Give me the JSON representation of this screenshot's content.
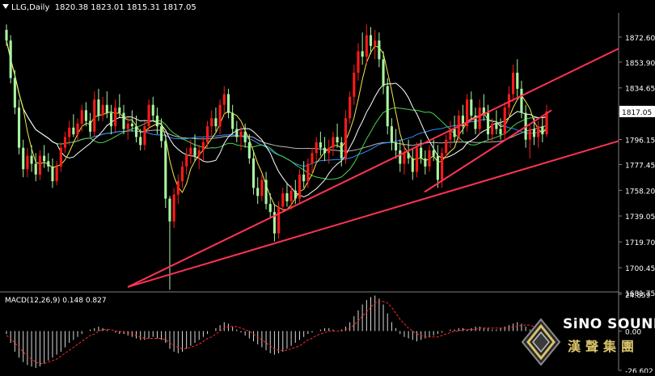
{
  "header": {
    "symbol": "LLG,Daily",
    "ohlc": "1820.38 1823.01 1815.31 1817.05"
  },
  "chart_data": [
    {
      "type": "candlestick",
      "title": "LLG,Daily",
      "ylim": [
        1681.75,
        1887
      ],
      "yticks": [
        "1872.60",
        "1853.90",
        "1834.65",
        "1815.35",
        "1796.15",
        "1777.45",
        "1758.20",
        "1739.05",
        "1719.70",
        "1700.45",
        "1681.75"
      ],
      "current_price": "1817.05",
      "candles": [
        {
          "o": 1878,
          "h": 1882,
          "l": 1866,
          "c": 1870
        },
        {
          "o": 1870,
          "h": 1874,
          "l": 1838,
          "c": 1842
        },
        {
          "o": 1842,
          "h": 1848,
          "l": 1815,
          "c": 1820
        },
        {
          "o": 1820,
          "h": 1826,
          "l": 1785,
          "c": 1790
        },
        {
          "o": 1790,
          "h": 1796,
          "l": 1768,
          "c": 1774
        },
        {
          "o": 1774,
          "h": 1790,
          "l": 1768,
          "c": 1784
        },
        {
          "o": 1784,
          "h": 1792,
          "l": 1772,
          "c": 1778
        },
        {
          "o": 1778,
          "h": 1786,
          "l": 1765,
          "c": 1770
        },
        {
          "o": 1770,
          "h": 1788,
          "l": 1766,
          "c": 1784
        },
        {
          "o": 1784,
          "h": 1792,
          "l": 1775,
          "c": 1780
        },
        {
          "o": 1780,
          "h": 1786,
          "l": 1772,
          "c": 1776
        },
        {
          "o": 1776,
          "h": 1782,
          "l": 1760,
          "c": 1765
        },
        {
          "o": 1765,
          "h": 1780,
          "l": 1762,
          "c": 1776
        },
        {
          "o": 1776,
          "h": 1794,
          "l": 1772,
          "c": 1790
        },
        {
          "o": 1790,
          "h": 1802,
          "l": 1786,
          "c": 1798
        },
        {
          "o": 1798,
          "h": 1810,
          "l": 1792,
          "c": 1805
        },
        {
          "o": 1805,
          "h": 1815,
          "l": 1798,
          "c": 1800
        },
        {
          "o": 1800,
          "h": 1812,
          "l": 1795,
          "c": 1808
        },
        {
          "o": 1808,
          "h": 1822,
          "l": 1802,
          "c": 1818
        },
        {
          "o": 1818,
          "h": 1824,
          "l": 1806,
          "c": 1810
        },
        {
          "o": 1810,
          "h": 1816,
          "l": 1798,
          "c": 1802
        },
        {
          "o": 1802,
          "h": 1832,
          "l": 1798,
          "c": 1826
        },
        {
          "o": 1826,
          "h": 1834,
          "l": 1810,
          "c": 1814
        },
        {
          "o": 1814,
          "h": 1828,
          "l": 1810,
          "c": 1822
        },
        {
          "o": 1822,
          "h": 1832,
          "l": 1812,
          "c": 1816
        },
        {
          "o": 1816,
          "h": 1822,
          "l": 1800,
          "c": 1806
        },
        {
          "o": 1806,
          "h": 1826,
          "l": 1802,
          "c": 1820
        },
        {
          "o": 1820,
          "h": 1830,
          "l": 1812,
          "c": 1816
        },
        {
          "o": 1816,
          "h": 1822,
          "l": 1800,
          "c": 1804
        },
        {
          "o": 1804,
          "h": 1812,
          "l": 1796,
          "c": 1808
        },
        {
          "o": 1808,
          "h": 1818,
          "l": 1802,
          "c": 1806
        },
        {
          "o": 1806,
          "h": 1814,
          "l": 1794,
          "c": 1798
        },
        {
          "o": 1798,
          "h": 1804,
          "l": 1788,
          "c": 1792
        },
        {
          "o": 1792,
          "h": 1810,
          "l": 1788,
          "c": 1806
        },
        {
          "o": 1806,
          "h": 1826,
          "l": 1802,
          "c": 1822
        },
        {
          "o": 1822,
          "h": 1828,
          "l": 1810,
          "c": 1814
        },
        {
          "o": 1814,
          "h": 1820,
          "l": 1800,
          "c": 1806
        },
        {
          "o": 1806,
          "h": 1812,
          "l": 1790,
          "c": 1795
        },
        {
          "o": 1795,
          "h": 1800,
          "l": 1745,
          "c": 1752
        },
        {
          "o": 1752,
          "h": 1754,
          "l": 1684,
          "c": 1735
        },
        {
          "o": 1735,
          "h": 1760,
          "l": 1730,
          "c": 1755
        },
        {
          "o": 1755,
          "h": 1770,
          "l": 1748,
          "c": 1765
        },
        {
          "o": 1765,
          "h": 1780,
          "l": 1760,
          "c": 1776
        },
        {
          "o": 1776,
          "h": 1790,
          "l": 1770,
          "c": 1785
        },
        {
          "o": 1785,
          "h": 1796,
          "l": 1778,
          "c": 1790
        },
        {
          "o": 1790,
          "h": 1800,
          "l": 1780,
          "c": 1784
        },
        {
          "o": 1784,
          "h": 1792,
          "l": 1774,
          "c": 1788
        },
        {
          "o": 1788,
          "h": 1798,
          "l": 1780,
          "c": 1794
        },
        {
          "o": 1794,
          "h": 1810,
          "l": 1790,
          "c": 1806
        },
        {
          "o": 1806,
          "h": 1818,
          "l": 1798,
          "c": 1812
        },
        {
          "o": 1812,
          "h": 1820,
          "l": 1802,
          "c": 1806
        },
        {
          "o": 1806,
          "h": 1826,
          "l": 1800,
          "c": 1822
        },
        {
          "o": 1822,
          "h": 1836,
          "l": 1815,
          "c": 1830
        },
        {
          "o": 1830,
          "h": 1834,
          "l": 1812,
          "c": 1816
        },
        {
          "o": 1816,
          "h": 1822,
          "l": 1800,
          "c": 1804
        },
        {
          "o": 1804,
          "h": 1810,
          "l": 1794,
          "c": 1798
        },
        {
          "o": 1798,
          "h": 1806,
          "l": 1788,
          "c": 1802
        },
        {
          "o": 1802,
          "h": 1808,
          "l": 1790,
          "c": 1794
        },
        {
          "o": 1794,
          "h": 1800,
          "l": 1778,
          "c": 1782
        },
        {
          "o": 1782,
          "h": 1788,
          "l": 1755,
          "c": 1760
        },
        {
          "o": 1760,
          "h": 1768,
          "l": 1748,
          "c": 1754
        },
        {
          "o": 1754,
          "h": 1770,
          "l": 1750,
          "c": 1766
        },
        {
          "o": 1766,
          "h": 1772,
          "l": 1744,
          "c": 1748
        },
        {
          "o": 1748,
          "h": 1756,
          "l": 1738,
          "c": 1742
        },
        {
          "o": 1742,
          "h": 1748,
          "l": 1720,
          "c": 1726
        },
        {
          "o": 1726,
          "h": 1750,
          "l": 1722,
          "c": 1746
        },
        {
          "o": 1746,
          "h": 1760,
          "l": 1742,
          "c": 1756
        },
        {
          "o": 1756,
          "h": 1764,
          "l": 1746,
          "c": 1750
        },
        {
          "o": 1750,
          "h": 1762,
          "l": 1744,
          "c": 1758
        },
        {
          "o": 1758,
          "h": 1766,
          "l": 1748,
          "c": 1752
        },
        {
          "o": 1752,
          "h": 1774,
          "l": 1748,
          "c": 1770
        },
        {
          "o": 1770,
          "h": 1780,
          "l": 1760,
          "c": 1765
        },
        {
          "o": 1765,
          "h": 1782,
          "l": 1760,
          "c": 1778
        },
        {
          "o": 1778,
          "h": 1790,
          "l": 1770,
          "c": 1786
        },
        {
          "o": 1786,
          "h": 1798,
          "l": 1780,
          "c": 1794
        },
        {
          "o": 1794,
          "h": 1802,
          "l": 1784,
          "c": 1790
        },
        {
          "o": 1790,
          "h": 1798,
          "l": 1780,
          "c": 1786
        },
        {
          "o": 1786,
          "h": 1796,
          "l": 1778,
          "c": 1790
        },
        {
          "o": 1790,
          "h": 1802,
          "l": 1784,
          "c": 1798
        },
        {
          "o": 1798,
          "h": 1808,
          "l": 1790,
          "c": 1794
        },
        {
          "o": 1794,
          "h": 1798,
          "l": 1776,
          "c": 1782
        },
        {
          "o": 1782,
          "h": 1818,
          "l": 1778,
          "c": 1812
        },
        {
          "o": 1812,
          "h": 1832,
          "l": 1808,
          "c": 1828
        },
        {
          "o": 1828,
          "h": 1852,
          "l": 1822,
          "c": 1846
        },
        {
          "o": 1846,
          "h": 1868,
          "l": 1840,
          "c": 1862
        },
        {
          "o": 1862,
          "h": 1876,
          "l": 1852,
          "c": 1858
        },
        {
          "o": 1858,
          "h": 1882,
          "l": 1852,
          "c": 1874
        },
        {
          "o": 1874,
          "h": 1880,
          "l": 1860,
          "c": 1866
        },
        {
          "o": 1866,
          "h": 1878,
          "l": 1856,
          "c": 1870
        },
        {
          "o": 1870,
          "h": 1876,
          "l": 1850,
          "c": 1856
        },
        {
          "o": 1856,
          "h": 1862,
          "l": 1830,
          "c": 1836
        },
        {
          "o": 1836,
          "h": 1842,
          "l": 1800,
          "c": 1806
        },
        {
          "o": 1806,
          "h": 1812,
          "l": 1788,
          "c": 1794
        },
        {
          "o": 1794,
          "h": 1804,
          "l": 1782,
          "c": 1788
        },
        {
          "o": 1788,
          "h": 1796,
          "l": 1772,
          "c": 1778
        },
        {
          "o": 1778,
          "h": 1792,
          "l": 1770,
          "c": 1786
        },
        {
          "o": 1786,
          "h": 1796,
          "l": 1778,
          "c": 1782
        },
        {
          "o": 1782,
          "h": 1790,
          "l": 1766,
          "c": 1772
        },
        {
          "o": 1772,
          "h": 1794,
          "l": 1768,
          "c": 1790
        },
        {
          "o": 1790,
          "h": 1796,
          "l": 1778,
          "c": 1782
        },
        {
          "o": 1782,
          "h": 1788,
          "l": 1770,
          "c": 1776
        },
        {
          "o": 1776,
          "h": 1792,
          "l": 1772,
          "c": 1788
        },
        {
          "o": 1788,
          "h": 1796,
          "l": 1780,
          "c": 1784
        },
        {
          "o": 1784,
          "h": 1792,
          "l": 1760,
          "c": 1766
        },
        {
          "o": 1766,
          "h": 1790,
          "l": 1760,
          "c": 1786
        },
        {
          "o": 1786,
          "h": 1800,
          "l": 1782,
          "c": 1796
        },
        {
          "o": 1796,
          "h": 1810,
          "l": 1790,
          "c": 1804
        },
        {
          "o": 1804,
          "h": 1814,
          "l": 1794,
          "c": 1798
        },
        {
          "o": 1798,
          "h": 1818,
          "l": 1794,
          "c": 1814
        },
        {
          "o": 1814,
          "h": 1822,
          "l": 1800,
          "c": 1806
        },
        {
          "o": 1806,
          "h": 1830,
          "l": 1802,
          "c": 1826
        },
        {
          "o": 1826,
          "h": 1832,
          "l": 1810,
          "c": 1814
        },
        {
          "o": 1814,
          "h": 1820,
          "l": 1800,
          "c": 1804
        },
        {
          "o": 1804,
          "h": 1826,
          "l": 1800,
          "c": 1820
        },
        {
          "o": 1820,
          "h": 1830,
          "l": 1810,
          "c": 1816
        },
        {
          "o": 1816,
          "h": 1822,
          "l": 1796,
          "c": 1800
        },
        {
          "o": 1800,
          "h": 1812,
          "l": 1794,
          "c": 1808
        },
        {
          "o": 1808,
          "h": 1818,
          "l": 1800,
          "c": 1804
        },
        {
          "o": 1804,
          "h": 1812,
          "l": 1796,
          "c": 1800
        },
        {
          "o": 1800,
          "h": 1824,
          "l": 1796,
          "c": 1820
        },
        {
          "o": 1820,
          "h": 1836,
          "l": 1814,
          "c": 1830
        },
        {
          "o": 1830,
          "h": 1852,
          "l": 1824,
          "c": 1846
        },
        {
          "o": 1846,
          "h": 1856,
          "l": 1828,
          "c": 1834
        },
        {
          "o": 1834,
          "h": 1840,
          "l": 1812,
          "c": 1816
        },
        {
          "o": 1816,
          "h": 1822,
          "l": 1790,
          "c": 1796
        },
        {
          "o": 1796,
          "h": 1808,
          "l": 1782,
          "c": 1804
        },
        {
          "o": 1804,
          "h": 1812,
          "l": 1792,
          "c": 1798
        },
        {
          "o": 1798,
          "h": 1810,
          "l": 1790,
          "c": 1806
        },
        {
          "o": 1806,
          "h": 1812,
          "l": 1794,
          "c": 1800
        },
        {
          "o": 1800,
          "h": 1822,
          "l": 1798,
          "c": 1817
        }
      ],
      "trendlines": [
        {
          "name": "upper-trendline",
          "x1": 39,
          "y1": 1686,
          "x2": 199,
          "y2": 1864
        },
        {
          "name": "lower-trendline",
          "x1": 39,
          "y1": 1686,
          "x2": 199,
          "y2": 1795
        }
      ]
    },
    {
      "type": "bar",
      "title": "MACD(12,26,9) 0.148 0.827",
      "ylim": [
        -26.602,
        24.859
      ],
      "yticks": [
        "24.859",
        "0.00",
        "-26.602"
      ],
      "histogram": [
        -2,
        -8,
        -14,
        -18,
        -21,
        -23,
        -24,
        -25,
        -24,
        -22,
        -20,
        -18,
        -16,
        -14,
        -11,
        -8,
        -6,
        -4,
        -2,
        0,
        1,
        2,
        3,
        2,
        1,
        0,
        -1,
        -2,
        -2,
        -3,
        -4,
        -5,
        -6,
        -6,
        -5,
        -4,
        -5,
        -6,
        -8,
        -12,
        -14,
        -15,
        -14,
        -12,
        -10,
        -8,
        -6,
        -4,
        -2,
        0,
        2,
        4,
        6,
        5,
        3,
        1,
        -1,
        -3,
        -5,
        -7,
        -9,
        -11,
        -13,
        -15,
        -16,
        -15,
        -14,
        -12,
        -10,
        -8,
        -6,
        -4,
        -2,
        -1,
        0,
        1,
        2,
        2,
        1,
        0,
        1,
        3,
        6,
        10,
        14,
        18,
        21,
        23,
        24,
        22,
        18,
        12,
        6,
        2,
        -2,
        -4,
        -5,
        -6,
        -7,
        -6,
        -5,
        -4,
        -3,
        -2,
        -1,
        0,
        1,
        1,
        2,
        2,
        1,
        2,
        3,
        3,
        2,
        2,
        1,
        1,
        2,
        3,
        4,
        5,
        6,
        5,
        3,
        1,
        -1,
        -2,
        -3,
        -3
      ],
      "signal": [
        -3,
        -5,
        -8,
        -11,
        -14,
        -17,
        -19,
        -21,
        -22,
        -22,
        -21,
        -20,
        -19,
        -17,
        -15,
        -13,
        -11,
        -9,
        -7,
        -5,
        -3,
        -2,
        0,
        1,
        1,
        1,
        0,
        0,
        -1,
        -1,
        -2,
        -3,
        -4,
        -5,
        -5,
        -5,
        -5,
        -5,
        -6,
        -8,
        -10,
        -11,
        -12,
        -12,
        -11,
        -10,
        -9,
        -7,
        -5,
        -4,
        -2,
        0,
        2,
        3,
        3,
        3,
        2,
        1,
        0,
        -2,
        -4,
        -6,
        -8,
        -10,
        -12,
        -13,
        -13,
        -13,
        -12,
        -11,
        -10,
        -8,
        -6,
        -5,
        -3,
        -2,
        -1,
        0,
        0,
        0,
        0,
        1,
        2,
        4,
        7,
        10,
        13,
        16,
        19,
        20,
        20,
        19,
        16,
        12,
        8,
        5,
        2,
        0,
        -2,
        -3,
        -4,
        -4,
        -4,
        -4,
        -3,
        -2,
        -1,
        0,
        0,
        1,
        1,
        1,
        1,
        2,
        2,
        2,
        2,
        2,
        2,
        2,
        2,
        3,
        3,
        4,
        4,
        4,
        3,
        2,
        1,
        0,
        -1
      ]
    }
  ],
  "macd_header": "MACD(12,26,9) 0.148 0.827",
  "colors": {
    "background": "#000000",
    "up_candle": "#ff1a1a",
    "down_candle": "#a8f5a0",
    "trendline": "#ff3355",
    "price_label_bg": "#ffffff",
    "axis_text": "#ffffff"
  },
  "brand": {
    "name": "SiNO SOUND",
    "chinese": "漢聲集團",
    "icon": "diamond-logo-icon"
  }
}
